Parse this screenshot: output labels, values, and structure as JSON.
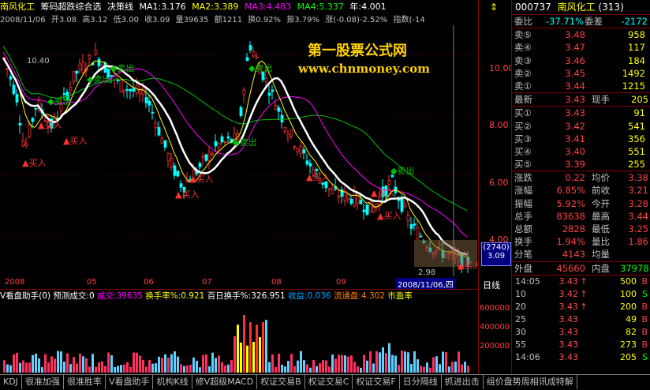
{
  "header": {
    "stock_name": "南风化工",
    "indicator": "筹码超跌综合选",
    "mode": "决策线",
    "ma1": "MA1:3.176",
    "ma2": "MA2:3.389",
    "ma3": "MA3:4.483",
    "ma4": "MA4:5.337",
    "year": "年:4.001"
  },
  "bar_info": {
    "date": "2008/11/06",
    "open": "开3.08",
    "high": "高3.12",
    "low": "低3.00",
    "close": "收3.09",
    "vol": "量39635",
    "amount": "额1211",
    "turnover": "换0.92%",
    "amplitude": "振3.79%",
    "change": "涨(-0.08)-2.52%",
    "index": "指数(-14"
  },
  "watermark": {
    "line1": "第一股票公式网",
    "line2": "www.chnmoney.com"
  },
  "price_axis": [
    "10.00",
    "8.00",
    "6.00",
    "4.00"
  ],
  "price_marks": {
    "high_label": "10.40",
    "low_label": "2.98",
    "cursor_top": "(2740)",
    "cursor_price": "3.09"
  },
  "time_axis": [
    "2008",
    "05",
    "06",
    "07",
    "08",
    "09",
    "2008/11/06,四"
  ],
  "signals": {
    "buy": "买入",
    "sell": "卖出"
  },
  "vol_header": {
    "name": "V看盘助手(0)",
    "predict": "预测成交:0",
    "deal": "成交:39635",
    "turnover_rate": "换手率%:0.921",
    "hundred_day": "百日换手%:326.951",
    "profit": "收益:0.036",
    "circulation": "流通盘:4.302",
    "pe": "市盈率"
  },
  "vol_axis": [
    "600000",
    "400000",
    "200000"
  ],
  "right_panel": {
    "code": "000737",
    "name": "南风化工",
    "num": "(313)",
    "ratio_label": "委比",
    "ratio": "-37.71%",
    "diff_label": "委差",
    "diff": "-2172",
    "sells": [
      {
        "label": "卖⑤",
        "price": "3.48",
        "vol": "958"
      },
      {
        "label": "卖④",
        "price": "3.47",
        "vol": "117"
      },
      {
        "label": "卖③",
        "price": "3.46",
        "vol": "184"
      },
      {
        "label": "卖②",
        "price": "3.45",
        "vol": "1492"
      },
      {
        "label": "卖①",
        "price": "3.44",
        "vol": "1215"
      }
    ],
    "latest_label": "最新",
    "latest": "3.43",
    "now_label": "现手",
    "now": "205",
    "buys": [
      {
        "label": "买①",
        "price": "3.43",
        "vol": "91"
      },
      {
        "label": "买②",
        "price": "3.42",
        "vol": "541"
      },
      {
        "label": "买③",
        "price": "3.41",
        "vol": "356"
      },
      {
        "label": "买④",
        "price": "3.40",
        "vol": "551"
      },
      {
        "label": "买⑤",
        "price": "3.39",
        "vol": "255"
      }
    ],
    "stats": [
      {
        "l1": "涨跌",
        "v1": "0.22",
        "l2": "均价",
        "v2": "3.38"
      },
      {
        "l1": "涨幅",
        "v1": "6.85%",
        "l2": "前收",
        "v2": "3.21"
      },
      {
        "l1": "振幅",
        "v1": "5.92%",
        "l2": "今开",
        "v2": "3.28"
      },
      {
        "l1": "总手",
        "v1": "83638",
        "l2": "最高",
        "v2": "3.44"
      },
      {
        "l1": "总额",
        "v1": "2828",
        "l2": "最低",
        "v2": "3.25"
      },
      {
        "l1": "换手",
        "v1": "1.94%",
        "l2": "量比",
        "v2": "1.86"
      },
      {
        "l1": "分笔",
        "v1": "4143",
        "l2": "均量",
        "v2": ""
      }
    ],
    "outer_label": "外盘",
    "outer": "45660",
    "inner_label": "内盘",
    "inner": "37978",
    "ticks": [
      {
        "t": "14:05",
        "p": "3.43",
        "ar": "↑",
        "v": "500",
        "s": "B"
      },
      {
        "t": "10",
        "p": "3.42",
        "ar": "↑",
        "v": "100",
        "s": "S"
      },
      {
        "t": "20",
        "p": "3.43",
        "ar": "↑",
        "v": "200",
        "s": "B"
      },
      {
        "t": "25",
        "p": "3.43",
        "ar": "",
        "v": "49",
        "s": "B"
      },
      {
        "t": "30",
        "p": "3.43",
        "ar": "",
        "v": "82",
        "s": "B"
      },
      {
        "t": "55",
        "p": "3.43",
        "ar": "",
        "v": "273",
        "s": "B"
      },
      {
        "t": "14:06",
        "p": "3.43",
        "ar": "",
        "v": "205",
        "s": "S"
      }
    ],
    "period": "日线"
  },
  "tabs": [
    "KDJ",
    "很准加强",
    "很准胜率",
    "V看盘助手",
    "机构K线",
    "修V超级MACD",
    "权证交易B",
    "权证交易C",
    "权证交易F",
    "日分隔线",
    "抓进出击",
    "组价盘势周相讯成特解"
  ],
  "colors": {
    "up": "#ff3030",
    "down": "#00ffff",
    "ma_white": "#ffffff",
    "ma_yellow": "#ffff00",
    "ma_magenta": "#ff00ff",
    "ma_green": "#00c000",
    "signal": "#ffff00"
  }
}
